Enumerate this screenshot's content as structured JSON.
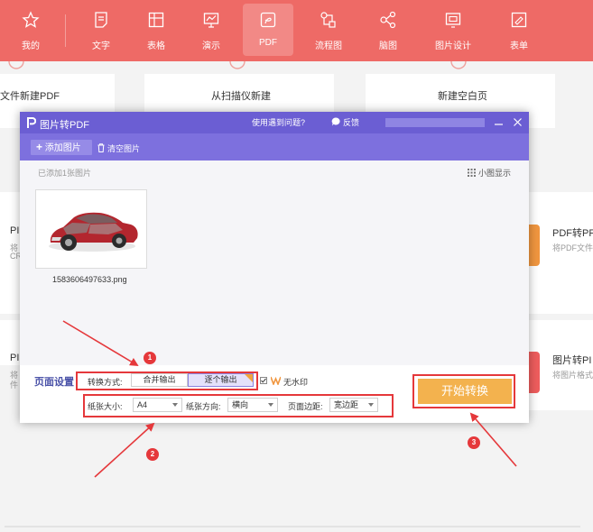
{
  "toolbar": {
    "items": [
      {
        "label": "我的",
        "icon": "star-icon"
      },
      {
        "label": "文字",
        "icon": "document-icon"
      },
      {
        "label": "表格",
        "icon": "table-icon"
      },
      {
        "label": "演示",
        "icon": "presentation-icon"
      },
      {
        "label": "PDF",
        "icon": "pdf-icon"
      },
      {
        "label": "流程图",
        "icon": "flowchart-icon"
      },
      {
        "label": "脑图",
        "icon": "mindmap-icon"
      },
      {
        "label": "图片设计",
        "icon": "image-design-icon"
      },
      {
        "label": "表单",
        "icon": "form-icon"
      }
    ],
    "active": "PDF",
    "bg_color": "#ee6a66"
  },
  "background": {
    "cards_top": [
      "文件新建PDF",
      "从扫描仪新建",
      "新建空白页"
    ],
    "left_labels": [
      "PI",
      "将",
      "CR",
      "PI",
      "将",
      "件"
    ],
    "right_items": [
      {
        "title": "PDF转PF",
        "desc": "将PDF文件转"
      },
      {
        "title": "图片转PI",
        "desc": "将图片格式"
      }
    ]
  },
  "dialog": {
    "title": "图片转PDF",
    "help_link": "使用遇到问题?",
    "feedback": "反馈",
    "toolbar": {
      "add_image": "添加图片",
      "clear_images": "清空图片"
    },
    "added_count_label": "已添加1张图片",
    "view_mode_label": "小图显示",
    "file": {
      "name": "1583606497633.png"
    },
    "settings": {
      "section_label": "页面设置",
      "convert_mode_label": "转换方式:",
      "convert_options": [
        "合并输出",
        "逐个输出"
      ],
      "selected_option": "逐个输出",
      "no_watermark_label": "无水印",
      "paper_size_label": "纸张大小:",
      "paper_size_value": "A4",
      "orientation_label": "纸张方向:",
      "orientation_value": "横向",
      "margin_label": "页面边距:",
      "margin_value": "宽边距"
    },
    "start_button": "开始转换",
    "colors": {
      "title_bar": "#6b5ed3",
      "toolbar": "#7d70de",
      "start_button": "#f3b24e"
    }
  },
  "annotations": {
    "markers": [
      "1",
      "2",
      "3"
    ],
    "color": "#e5383b"
  }
}
